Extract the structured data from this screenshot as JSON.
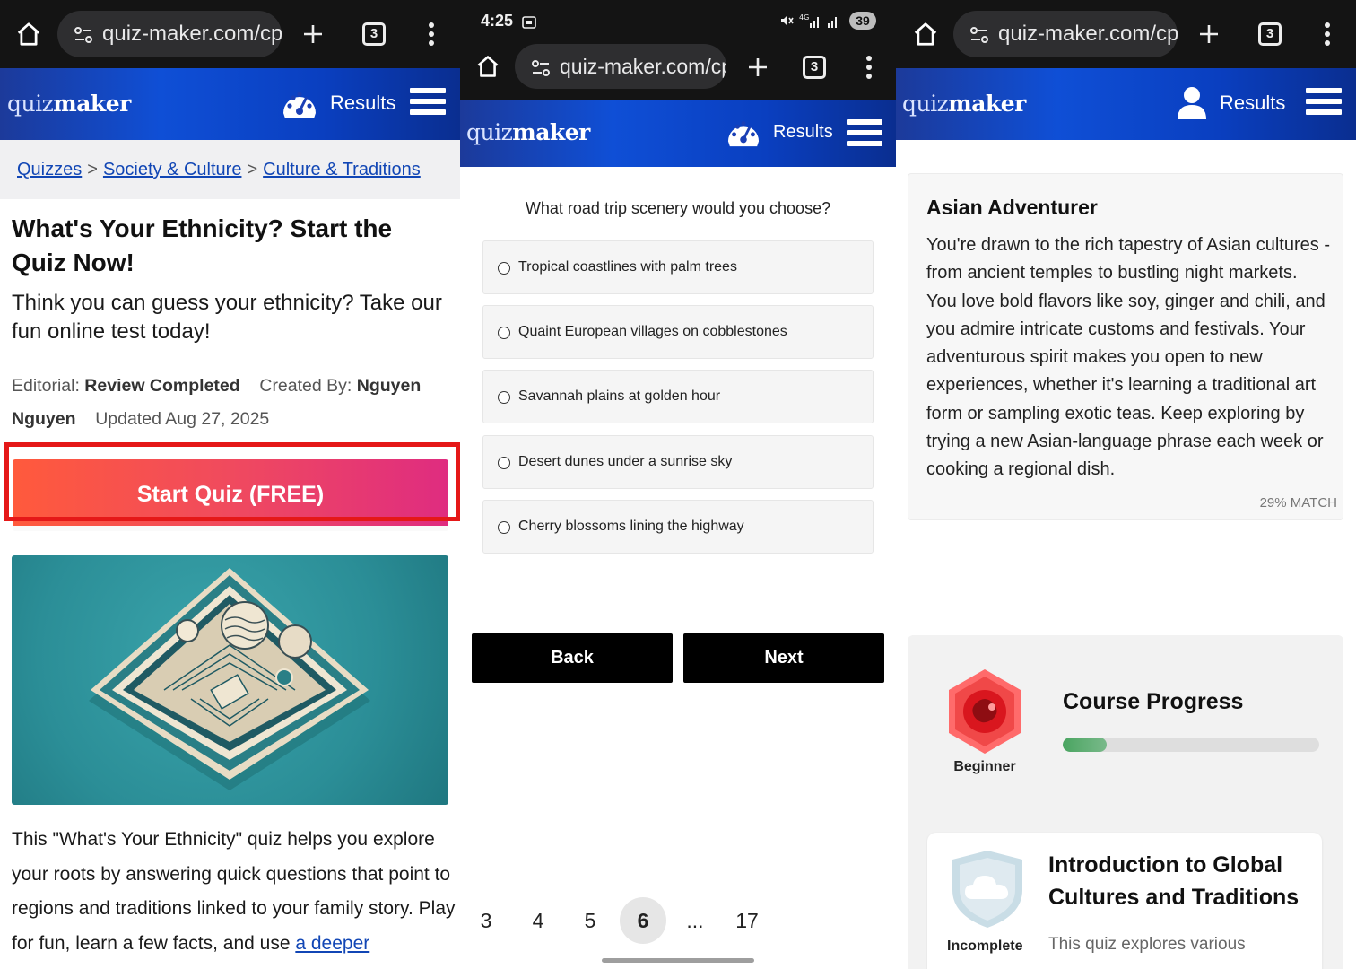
{
  "browser": {
    "url": "quiz-maker.com/cp-",
    "tab_count": "3"
  },
  "status_bar": {
    "time": "4:25",
    "battery": "39"
  },
  "site": {
    "logo_light": "quiz",
    "logo_bold": "maker",
    "results_label": "Results"
  },
  "panel1": {
    "breadcrumbs": [
      "Quizzes",
      "Society & Culture",
      "Culture & Traditions"
    ],
    "breadcrumb_sep": ">",
    "title": "What's Your Ethnicity? Start the Quiz Now!",
    "lead": "Think you can guess your ethnicity? Take our fun online test today!",
    "editorial_label": "Editorial:",
    "editorial_value": "Review Completed",
    "created_label": "Created By:",
    "created_value": "Nguyen Nguyen",
    "updated": "Updated Aug 27, 2025",
    "start_button": "Start Quiz (FREE)",
    "description": "This \"What's Your Ethnicity\" quiz helps you explore your roots by answering quick questions that point to regions and traditions linked to your family story. Play for fun, learn a few facts, and use ",
    "description_link": "a deeper"
  },
  "panel2": {
    "question": "What road trip scenery would you choose?",
    "options": [
      "Tropical coastlines with palm trees",
      "Quaint European villages on cobblestones",
      "Savannah plains at golden hour",
      "Desert dunes under a sunrise sky",
      "Cherry blossoms lining the highway"
    ],
    "back_label": "Back",
    "next_label": "Next",
    "pages": [
      "3",
      "4",
      "5",
      "6",
      "...",
      "17"
    ],
    "current_page": "6"
  },
  "panel3": {
    "result_title": "Asian Adventurer",
    "result_text": "You're drawn to the rich tapestry of Asian cultures - from ancient temples to bustling night markets. You love bold flavors like soy, ginger and chili, and you admire intricate customs and festivals. Your adventurous spirit makes you open to new experiences, whether it's learning a traditional art form or sampling exotic teas. Keep exploring by trying a new Asian-language phrase each week or cooking a regional dish.",
    "match": "29% MATCH",
    "progress_title": "Course Progress",
    "progress_fraction": 0.17,
    "badge_label": "Beginner",
    "course_title": "Introduction to Global Cultures and Traditions",
    "course_status": "Incomplete",
    "course_desc": "This quiz explores various"
  },
  "colors": {
    "header_blue": "#0f4fd6",
    "cta_start": "#ff5a3c",
    "cta_end": "#df2c80",
    "highlight_red": "#e51818",
    "link_blue": "#1146b5",
    "progress_green": "#4aa561"
  }
}
